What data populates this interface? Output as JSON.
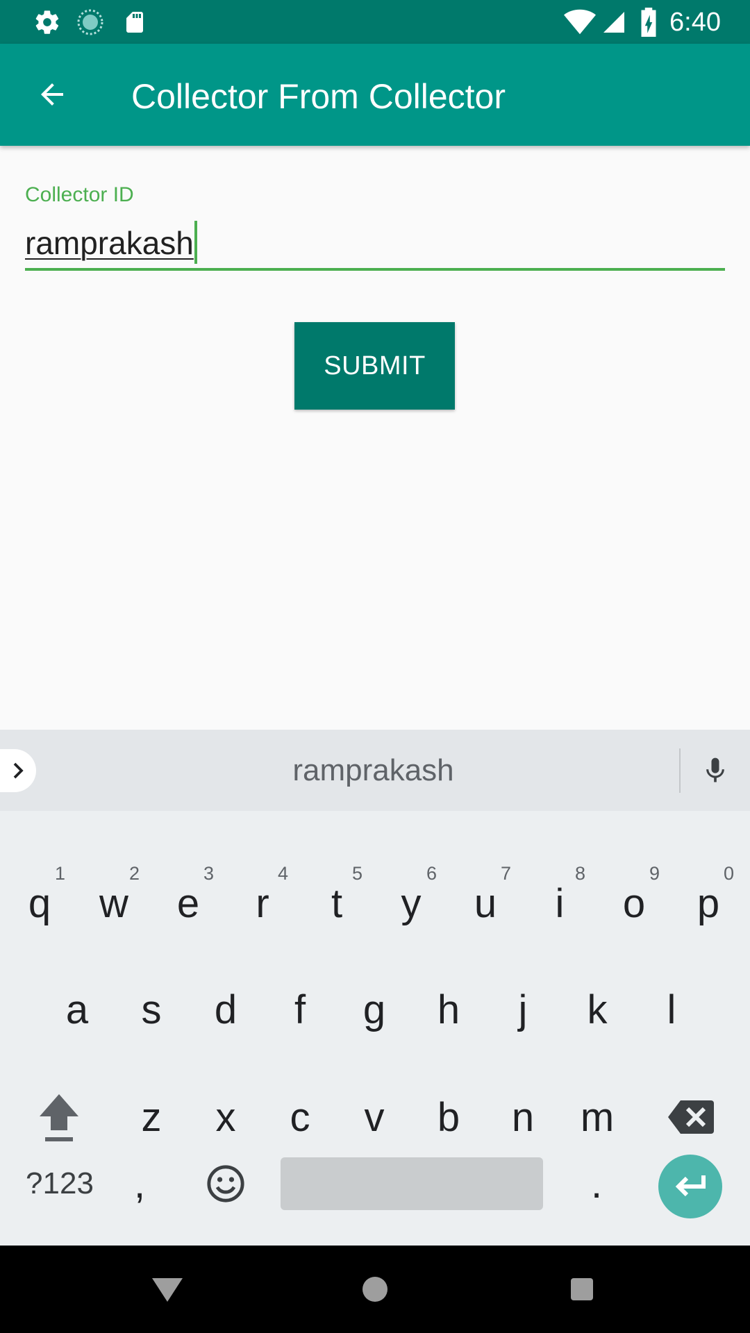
{
  "status_bar": {
    "time": "6:40",
    "left_icons": [
      "settings-icon",
      "sync-icon",
      "sd-card-icon"
    ],
    "right_icons": [
      "wifi-icon",
      "signal-icon",
      "battery-charging-icon"
    ]
  },
  "app_bar": {
    "title": "Collector From Collector",
    "back_icon": "arrow-left-icon"
  },
  "form": {
    "label": "Collector ID",
    "value": "ramprakash",
    "submit_label": "SUBMIT"
  },
  "keyboard": {
    "suggestion": "ramprakash",
    "row1": [
      {
        "key": "q",
        "num": "1"
      },
      {
        "key": "w",
        "num": "2"
      },
      {
        "key": "e",
        "num": "3"
      },
      {
        "key": "r",
        "num": "4"
      },
      {
        "key": "t",
        "num": "5"
      },
      {
        "key": "y",
        "num": "6"
      },
      {
        "key": "u",
        "num": "7"
      },
      {
        "key": "i",
        "num": "8"
      },
      {
        "key": "o",
        "num": "9"
      },
      {
        "key": "p",
        "num": "0"
      }
    ],
    "row2": [
      "a",
      "s",
      "d",
      "f",
      "g",
      "h",
      "j",
      "k",
      "l"
    ],
    "row3": [
      "z",
      "x",
      "c",
      "v",
      "b",
      "n",
      "m"
    ],
    "symbols_label": "?123",
    "comma": ",",
    "period": "."
  },
  "colors": {
    "status_bar": "#00796b",
    "app_bar": "#009688",
    "accent": "#4caf50",
    "button": "#00796b",
    "enter_key": "#4db6ac"
  }
}
